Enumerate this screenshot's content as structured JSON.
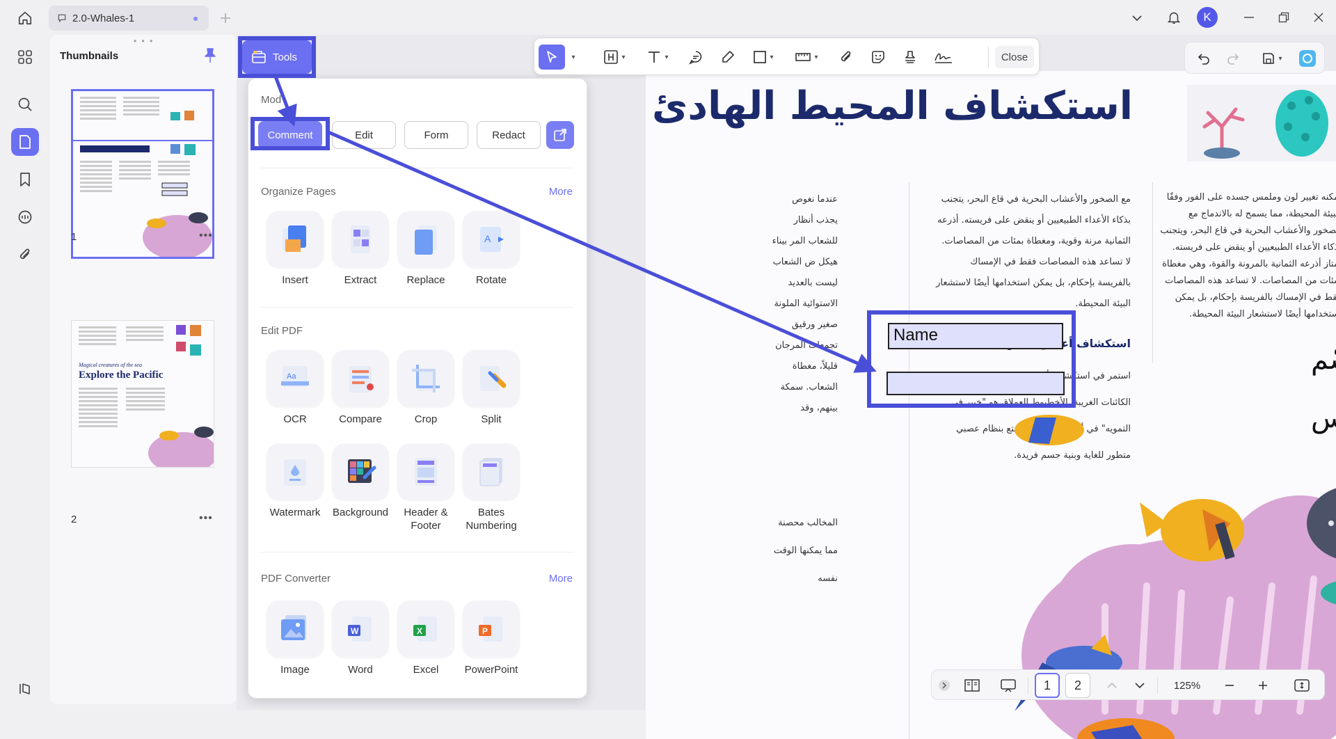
{
  "titlebar": {
    "doc_tab": "2.0-Whales-1",
    "avatar_letter": "K"
  },
  "sidebar": {
    "thumbnails_title": "Thumbnails",
    "pages": [
      {
        "num": "1"
      },
      {
        "num": "2"
      }
    ]
  },
  "thumb2": {
    "subtitle": "Magical creatures of the sea",
    "title": "Explore the Pacific"
  },
  "toolbar": {
    "close_label": "Close"
  },
  "tools_button": {
    "label": "Tools"
  },
  "tools_panel": {
    "mode_title": "Mod",
    "modes": [
      {
        "label": "Comment"
      },
      {
        "label": "Edit"
      },
      {
        "label": "Form"
      },
      {
        "label": "Redact"
      }
    ],
    "organize": {
      "title": "Organize Pages",
      "more": "More",
      "items": [
        {
          "label": "Insert"
        },
        {
          "label": "Extract"
        },
        {
          "label": "Replace"
        },
        {
          "label": "Rotate"
        }
      ]
    },
    "edit": {
      "title": "Edit PDF",
      "items": [
        {
          "label": "OCR"
        },
        {
          "label": "Compare"
        },
        {
          "label": "Crop"
        },
        {
          "label": "Split"
        },
        {
          "label": "Watermark"
        },
        {
          "label": "Background"
        },
        {
          "label": "Header &\nFooter"
        },
        {
          "label": "Bates\nNumbering"
        }
      ]
    },
    "converter": {
      "title": "PDF Converter",
      "more": "More",
      "items": [
        {
          "label": "Image"
        },
        {
          "label": "Word"
        },
        {
          "label": "Excel"
        },
        {
          "label": "PowerPoint"
        }
      ]
    }
  },
  "document": {
    "heading": "استكشاف المحيط الهادئ",
    "col_right": "يمكنه تغيير لون وملمس جسده على الفور وفقًا للبيئة المحيطة، مما يسمح له بالاندماج مع الصخور والأعشاب البحرية في قاع البحر، ويتجنب بذكاء الأعداء الطبيعيين أو ينقض على فريسته. تمتاز أذرعه الثمانية بالمرونة والقوة، وهي مغطاة بمئات من المصاصات. لا تساعد هذه المصاصات فقط في الإمساك بالفريسة بإحكام، بل يمكن استخدامها أيضًا لاستشعار البيئة المحيطة.",
    "col_mid": "مع الصخور والأعشاب البحرية في قاع البحر، يتجنب بذكاء الأعداء الطبيعيين أو ينقض على فريسته. أذرعه الثمانية مرنة وقوية، ومغطاة بمئات من المصاصات. لا تساعد هذه المصاصات فقط في الإمساك بالفريسة بإحكام، بل يمكن استخدامها أيضًا لاستشعار البيئة المحيطة.",
    "sub_heading": "استكشاف أعماق البحر",
    "col_mid_2": "استمر في استكشاف أعماق البحر وسنواجه بعض الكائنات الغريبة. الأخطبوط العملاق هو \"خبير في التمويه\" في أعماق المحيط، يتمتع بنظام عصبي متطور للغاية وبنية جسم فريدة.",
    "col_left": "عندما نغوص يجذب أنظار للشعاب المر بيناء هيكل ض الشعاب ليست بالعديد الاستوائية الملونة صغير ورقيق تجمعات المرجان قليلاً، مغطاة الشعاب. سمكة بينهم، وقد",
    "col_left_2": "المخالب محصنة مما يمكنها الوقت نفسه",
    "field_labels": {
      "name": "إسْم",
      "gender": "جِنْس"
    },
    "name_field_value": "Name",
    "gender_field_value": ""
  },
  "bottom_bar": {
    "pages": [
      "1",
      "2"
    ],
    "zoom": "125%"
  },
  "colors": {
    "accent": "#6b6ff2",
    "annotation": "#4a4fd8",
    "field_fill": "#dfe0fb"
  }
}
